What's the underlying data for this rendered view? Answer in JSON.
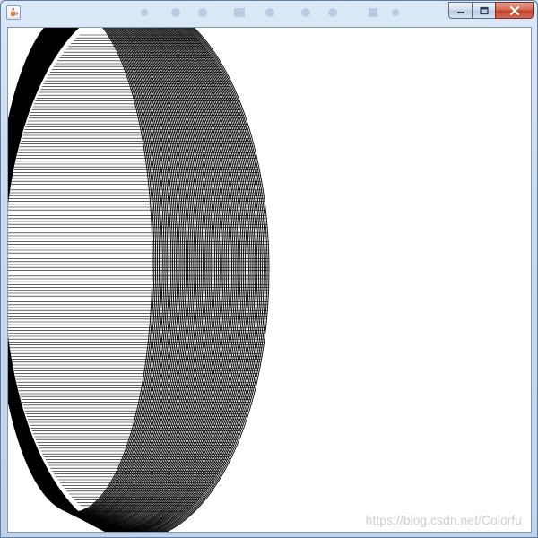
{
  "window": {
    "title": "",
    "icons": {
      "app": "java-coffee-icon",
      "minimize": "minimize-icon",
      "maximize": "maximize-icon",
      "close": "close-icon"
    },
    "colors": {
      "frame": "#c9dcf0",
      "close_button": "#c2402a",
      "canvas_background": "#ffffff",
      "stroke": "#000000"
    }
  },
  "canvas": {
    "description_type": "nested-ellipses-line-art",
    "watermark": "https://blog.csdn.net/Colorfu"
  }
}
